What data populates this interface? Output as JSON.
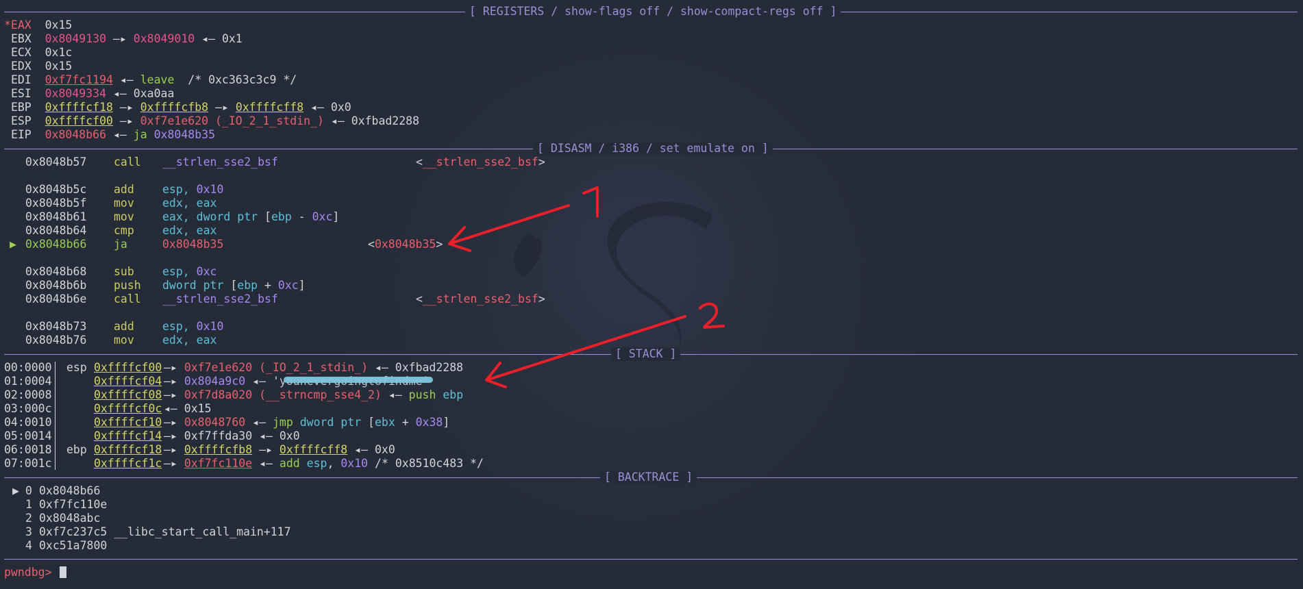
{
  "colors": {
    "background": "#262b38",
    "header": "#9a8fd8",
    "address_red": "#e8606f",
    "stack_yellow": "#d3d667",
    "instr_green": "#9acd52",
    "register_cyan": "#5fc0d8",
    "number_purple": "#a68af0",
    "annotation_red": "#e8202a"
  },
  "headers": {
    "registers": "[ REGISTERS / show-flags off / show-compact-regs off ]",
    "disasm": "[ DISASM / i386 / set emulate on ]",
    "stack": "[ STACK ]",
    "backtrace": "[ BACKTRACE ]"
  },
  "registers": {
    "eax": {
      "name": "*EAX",
      "value": "0x15"
    },
    "ebx": {
      "name": "EBX",
      "v1": "0x8049130",
      "arrow1": "—▸",
      "v2": "0x8049010",
      "arrow2": "◂—",
      "v3": "0x1"
    },
    "ecx": {
      "name": "ECX",
      "value": "0x1c"
    },
    "edx": {
      "name": "EDX",
      "value": "0x15"
    },
    "edi": {
      "name": "EDI",
      "v1": "0xf7fc1194",
      "arrow": "◂—",
      "instr": "leave",
      "comment": "/* 0xc363c3c9 */"
    },
    "esi": {
      "name": "ESI",
      "v1": "0x8049334",
      "arrow": "◂—",
      "v2": "0xa0aa"
    },
    "ebp": {
      "name": "EBP",
      "v1": "0xffffcf18",
      "a1": "—▸",
      "v2": "0xffffcfb8",
      "a2": "—▸",
      "v3": "0xffffcff8",
      "a3": "◂—",
      "v4": "0x0"
    },
    "esp": {
      "name": "ESP",
      "v1": "0xffffcf00",
      "a1": "—▸",
      "v2": "0xf7e1e620",
      "sym": "(_IO_2_1_stdin_)",
      "a2": "◂—",
      "v3": "0xfbad2288"
    },
    "eip": {
      "name": "EIP",
      "v1": "0x8048b66",
      "arrow": "◂—",
      "instr": "ja",
      "target": "0x8048b35"
    }
  },
  "disasm": [
    {
      "addr": "0x8048b57",
      "mnem": "call",
      "op": "__strlen_sse2_bsf",
      "target": "<__strlen_sse2_bsf>"
    },
    {
      "addr": "0x8048b5c",
      "mnem": "add",
      "op_a": "esp,",
      "op_b": "0x10"
    },
    {
      "addr": "0x8048b5f",
      "mnem": "mov",
      "op_a": "edx,",
      "op_b": "eax"
    },
    {
      "addr": "0x8048b61",
      "mnem": "mov",
      "op_a": "eax,",
      "op_b": "dword ptr [ebp - 0xc]"
    },
    {
      "addr": "0x8048b64",
      "mnem": "cmp",
      "op_a": "edx,",
      "op_b": "eax"
    },
    {
      "marker": "▶",
      "addr": "0x8048b66",
      "mnem": "ja",
      "op": "0x8048b35",
      "target": "<0x8048b35>"
    },
    {
      "addr": "0x8048b68",
      "mnem": "sub",
      "op_a": "esp,",
      "op_b": "0xc"
    },
    {
      "addr": "0x8048b6b",
      "mnem": "push",
      "op_a": "dword ptr",
      "op_b": "[ebp + 0xc]"
    },
    {
      "addr": "0x8048b6e",
      "mnem": "call",
      "op": "__strlen_sse2_bsf",
      "target": "<__strlen_sse2_bsf>"
    },
    {
      "addr": "0x8048b73",
      "mnem": "add",
      "op_a": "esp,",
      "op_b": "0x10"
    },
    {
      "addr": "0x8048b76",
      "mnem": "mov",
      "op_a": "edx,",
      "op_b": "eax"
    }
  ],
  "stack": [
    {
      "off": "00:0000",
      "reg": "esp",
      "addr": "0xffffcf00",
      "rest": [
        [
          "—▸ ",
          "grey"
        ],
        [
          "0xf7e1e620 (_IO_2_1_stdin_)",
          "red"
        ],
        [
          " ◂— 0xfbad2288",
          "grey"
        ]
      ]
    },
    {
      "off": "01:0004",
      "reg": "",
      "addr": "0xffffcf04",
      "rest": [
        [
          "—▸ ",
          "grey"
        ],
        [
          "0x804a9c0",
          "purp"
        ],
        [
          " ◂— '",
          "grey"
        ],
        [
          "younevergoingtofindme",
          "dim"
        ],
        [
          "'",
          "grey"
        ]
      ]
    },
    {
      "off": "02:0008",
      "reg": "",
      "addr": "0xffffcf08",
      "rest": [
        [
          "—▸ ",
          "grey"
        ],
        [
          "0xf7d8a020 (__strncmp_sse4_2)",
          "red"
        ],
        [
          " ◂— ",
          "grey"
        ],
        [
          "push ",
          "grn"
        ],
        [
          "ebp",
          "cyan"
        ]
      ]
    },
    {
      "off": "03:000c",
      "reg": "",
      "addr": "0xffffcf0c",
      "rest": [
        [
          "◂— 0x15",
          "grey"
        ]
      ]
    },
    {
      "off": "04:0010",
      "reg": "",
      "addr": "0xffffcf10",
      "rest": [
        [
          "—▸ ",
          "grey"
        ],
        [
          "0x8048760",
          "red"
        ],
        [
          " ◂— ",
          "grey"
        ],
        [
          "jmp ",
          "grn"
        ],
        [
          "dword ptr ",
          "cyan"
        ],
        [
          "[",
          "grey"
        ],
        [
          "ebx",
          "cyan"
        ],
        [
          " + ",
          "grey"
        ],
        [
          "0x38",
          "purp"
        ],
        [
          "]",
          "grey"
        ]
      ]
    },
    {
      "off": "05:0014",
      "reg": "",
      "addr": "0xffffcf14",
      "rest": [
        [
          "—▸ 0xf7ffda30 ◂— 0x0",
          "grey"
        ]
      ]
    },
    {
      "off": "06:0018",
      "reg": "ebp",
      "addr": "0xffffcf18",
      "rest": [
        [
          "—▸ ",
          "grey"
        ],
        [
          "0xffffcfb8",
          "yelul"
        ],
        [
          " —▸ ",
          "grey"
        ],
        [
          "0xffffcff8",
          "yelul"
        ],
        [
          " ◂— 0x0",
          "grey"
        ]
      ]
    },
    {
      "off": "07:001c",
      "reg": "",
      "addr": "0xffffcf1c",
      "rest": [
        [
          "—▸ ",
          "grey"
        ],
        [
          "0xf7fc110e",
          "redul"
        ],
        [
          " ◂— ",
          "grey"
        ],
        [
          "add ",
          "grn"
        ],
        [
          "esp",
          "cyan"
        ],
        [
          ", ",
          "grey"
        ],
        [
          "0x10",
          "purp"
        ],
        [
          " /* 0x8510c483 */",
          "grey"
        ]
      ]
    }
  ],
  "backtrace": [
    {
      "marker": "▶",
      "idx": "0",
      "text": "0x8048b66"
    },
    {
      "marker": "",
      "idx": "1",
      "text": "0xf7fc110e"
    },
    {
      "marker": "",
      "idx": "2",
      "text": "0x8048abc"
    },
    {
      "marker": "",
      "idx": "3",
      "text": "0xf7c237c5 __libc_start_call_main+117"
    },
    {
      "marker": "",
      "idx": "4",
      "text": "0xc51a7800"
    }
  ],
  "prompt": "pwndbg>",
  "annotations": [
    {
      "label": "1"
    },
    {
      "label": "2"
    }
  ]
}
